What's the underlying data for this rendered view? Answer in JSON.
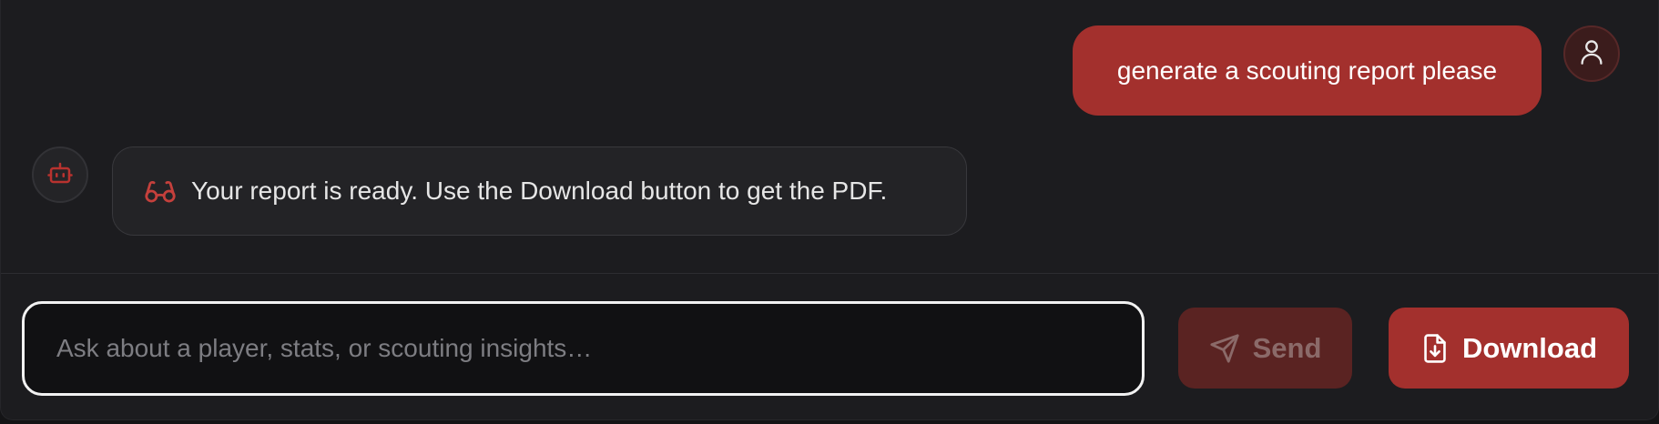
{
  "messages": [
    {
      "role": "user",
      "text": "generate a scouting report please",
      "avatar_icon": "user-icon"
    },
    {
      "role": "assistant",
      "text": "Your report is ready. Use the Download button to get the PDF.",
      "avatar_icon": "robot-icon",
      "inline_icon": "glasses-icon"
    }
  ],
  "composer": {
    "placeholder": "Ask about a player, stats, or scouting insights…",
    "value": "",
    "send_label": "Send",
    "send_icon": "send-icon",
    "send_disabled": true,
    "download_label": "Download",
    "download_icon": "file-download-icon"
  },
  "colors": {
    "accent": "#a3302d",
    "accent_disabled": "#5a2322",
    "background": "#1c1c1f",
    "bubble_bot": "#232326"
  }
}
